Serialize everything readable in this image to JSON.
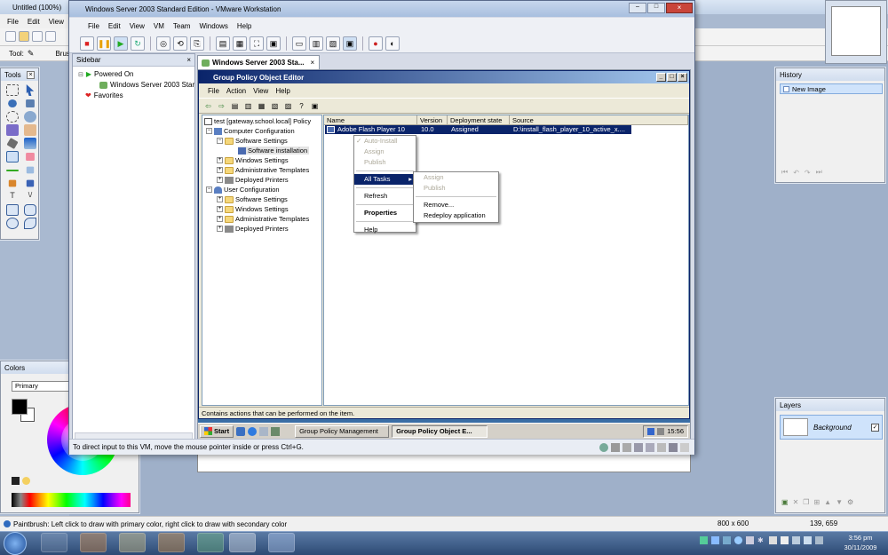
{
  "paintnet": {
    "title": "Untitled (100%)",
    "menu": [
      "File",
      "Edit",
      "View"
    ],
    "tool_label": "Tool:",
    "brush_label": "Brus",
    "tools_title": "Tools",
    "colors_title": "Colors",
    "colors_mode": "Primary",
    "history_title": "History",
    "history_items": [
      "New Image"
    ],
    "layers_title": "Layers",
    "layer_name": "Background",
    "status_text": "Paintbrush: Left click to draw with primary color, right click to draw with secondary color",
    "image_size": "800 x 600",
    "cursor_pos": "139, 659",
    "primary_color": "#000000",
    "secondary_color": "#ffffff"
  },
  "vmware": {
    "title": "Windows Server 2003 Standard Edition - VMware Workstation",
    "menu": [
      "File",
      "Edit",
      "View",
      "VM",
      "Team",
      "Windows",
      "Help"
    ],
    "sidebar_title": "Sidebar",
    "powered_on": "Powered On",
    "vm_name": "Windows Server 2003 Star",
    "favorites": "Favorites",
    "tab_label": "Windows Server 2003 Sta...",
    "status_text": "To direct input to this VM, move the mouse pointer inside or press Ctrl+G."
  },
  "gpo": {
    "title": "Group Policy Object Editor",
    "menu": [
      "File",
      "Action",
      "View",
      "Help"
    ],
    "tree": {
      "root": "test [gateway.school.local] Policy",
      "computer_config": "Computer Configuration",
      "software_settings": "Software Settings",
      "software_installation": "Software installation",
      "windows_settings": "Windows Settings",
      "admin_templates": "Administrative Templates",
      "deployed_printers": "Deployed Printers",
      "user_config": "User Configuration",
      "u_software_settings": "Software Settings",
      "u_windows_settings": "Windows Settings",
      "u_admin_templates": "Administrative Templates",
      "u_deployed_printers": "Deployed Printers"
    },
    "columns": [
      "Name",
      "Version",
      "Deployment state",
      "Source"
    ],
    "row": {
      "name": "Adobe Flash Player 10",
      "version": "10.0",
      "state": "Assigned",
      "source": "D:\\install_flash_player_10_active_x...."
    },
    "status_text": "Contains actions that can be performed on the item."
  },
  "context_menu": {
    "auto_install": "Auto-Install",
    "assign": "Assign",
    "publish": "Publish",
    "all_tasks": "All Tasks",
    "refresh": "Refresh",
    "properties": "Properties",
    "help": "Help"
  },
  "submenu": {
    "assign": "Assign",
    "publish": "Publish",
    "remove": "Remove...",
    "redeploy": "Redeploy application"
  },
  "vm_taskbar": {
    "start": "Start",
    "task1": "Group Policy Management",
    "task2": "Group Policy Object E...",
    "time": "15:56"
  },
  "win7_taskbar": {
    "time": "3:56 pm",
    "date": "30/11/2009"
  }
}
